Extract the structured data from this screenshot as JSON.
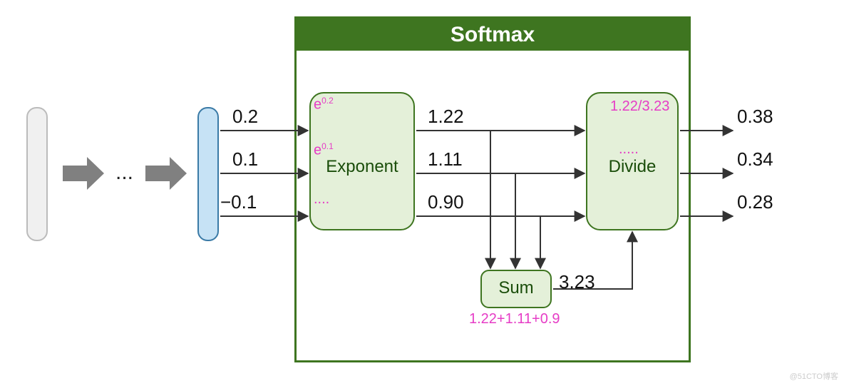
{
  "title": "Softmax",
  "nodes": {
    "exponent": "Exponent",
    "divide": "Divide",
    "sum": "Sum"
  },
  "inputs": {
    "v1": "0.2",
    "v2": "0.1",
    "v3": "−0.1"
  },
  "exp_vals": {
    "v1": "1.22",
    "v2": "1.11",
    "v3": "0.90"
  },
  "sum_val": "3.23",
  "outputs": {
    "v1": "0.38",
    "v2": "0.34",
    "v3": "0.28"
  },
  "annotations": {
    "exp1": "e",
    "exp1_sup": "0.2",
    "exp2": "e",
    "exp2_sup": "0.1",
    "exp3": "....",
    "div1": "1.22/3.23",
    "div2": ".....",
    "sum_expr": "1.22+1.11+0.9"
  },
  "ellipsis": "...",
  "watermark": "@51CTO博客"
}
